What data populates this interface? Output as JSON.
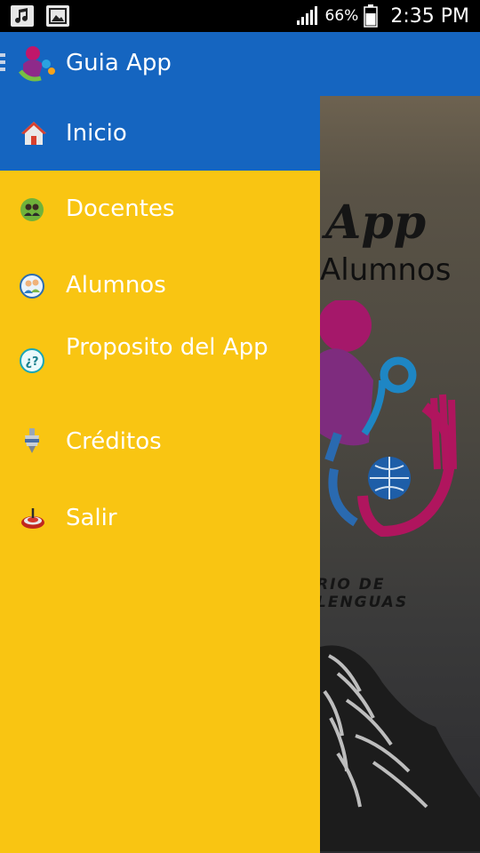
{
  "status_bar": {
    "battery_percent": "66%",
    "time": "2:35 PM",
    "icons": [
      "music-note-icon",
      "image-icon",
      "signal-icon",
      "battery-icon"
    ]
  },
  "app_bar": {
    "title": "Guia App",
    "icons": [
      "menu-handle-icon",
      "app-logo-icon"
    ],
    "color": "#1565c0"
  },
  "drawer": {
    "color": "#f9c512",
    "items": [
      {
        "label": "Inicio",
        "icon": "home-icon",
        "active": true
      },
      {
        "label": "Docentes",
        "icon": "teachers-icon",
        "active": false
      },
      {
        "label": "Alumnos",
        "icon": "students-icon",
        "active": false
      },
      {
        "label": "Proposito del App",
        "icon": "question-icon",
        "active": false
      },
      {
        "label": "Créditos",
        "icon": "credits-icon",
        "active": false
      },
      {
        "label": "Salir",
        "icon": "exit-icon",
        "active": false
      }
    ]
  },
  "background": {
    "app_text": "App",
    "alumnos_text": "Alumnos",
    "lenguas_text": "RIO DE LENGUAS"
  }
}
